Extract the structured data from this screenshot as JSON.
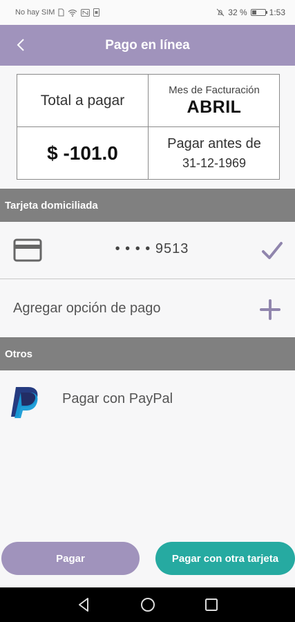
{
  "status_bar": {
    "carrier": "No hay SIM",
    "battery_percent": "32 %",
    "battery_level": 0.32,
    "time": "1:53"
  },
  "app_bar": {
    "title": "Pago en línea",
    "back_icon": "chevron-left-icon"
  },
  "summary": {
    "total_label": "Total a pagar",
    "amount": "$ -101.0",
    "billing_month_label": "Mes de Facturación",
    "billing_month": "ABRIL",
    "due_label": "Pagar antes de",
    "due_date": "31-12-1969"
  },
  "sections": {
    "card_header": "Tarjeta domiciliada",
    "others_header": "Otros"
  },
  "card": {
    "icon": "credit-card-icon",
    "number": "• • • • 9513",
    "selected_icon": "check-icon"
  },
  "add_payment": {
    "label": "Agregar opción de pago",
    "icon": "plus-icon"
  },
  "paypal": {
    "icon": "paypal-logo",
    "label": "Pagar con PayPal"
  },
  "buttons": {
    "pay": "Pagar",
    "pay_other": "Pagar con otra tarjeta"
  },
  "colors": {
    "primary": "#a093bc",
    "accent": "#26aaa1",
    "section_header": "#808080"
  },
  "nav": {
    "back": "triangle-back-icon",
    "home": "circle-home-icon",
    "recent": "square-recent-icon"
  }
}
